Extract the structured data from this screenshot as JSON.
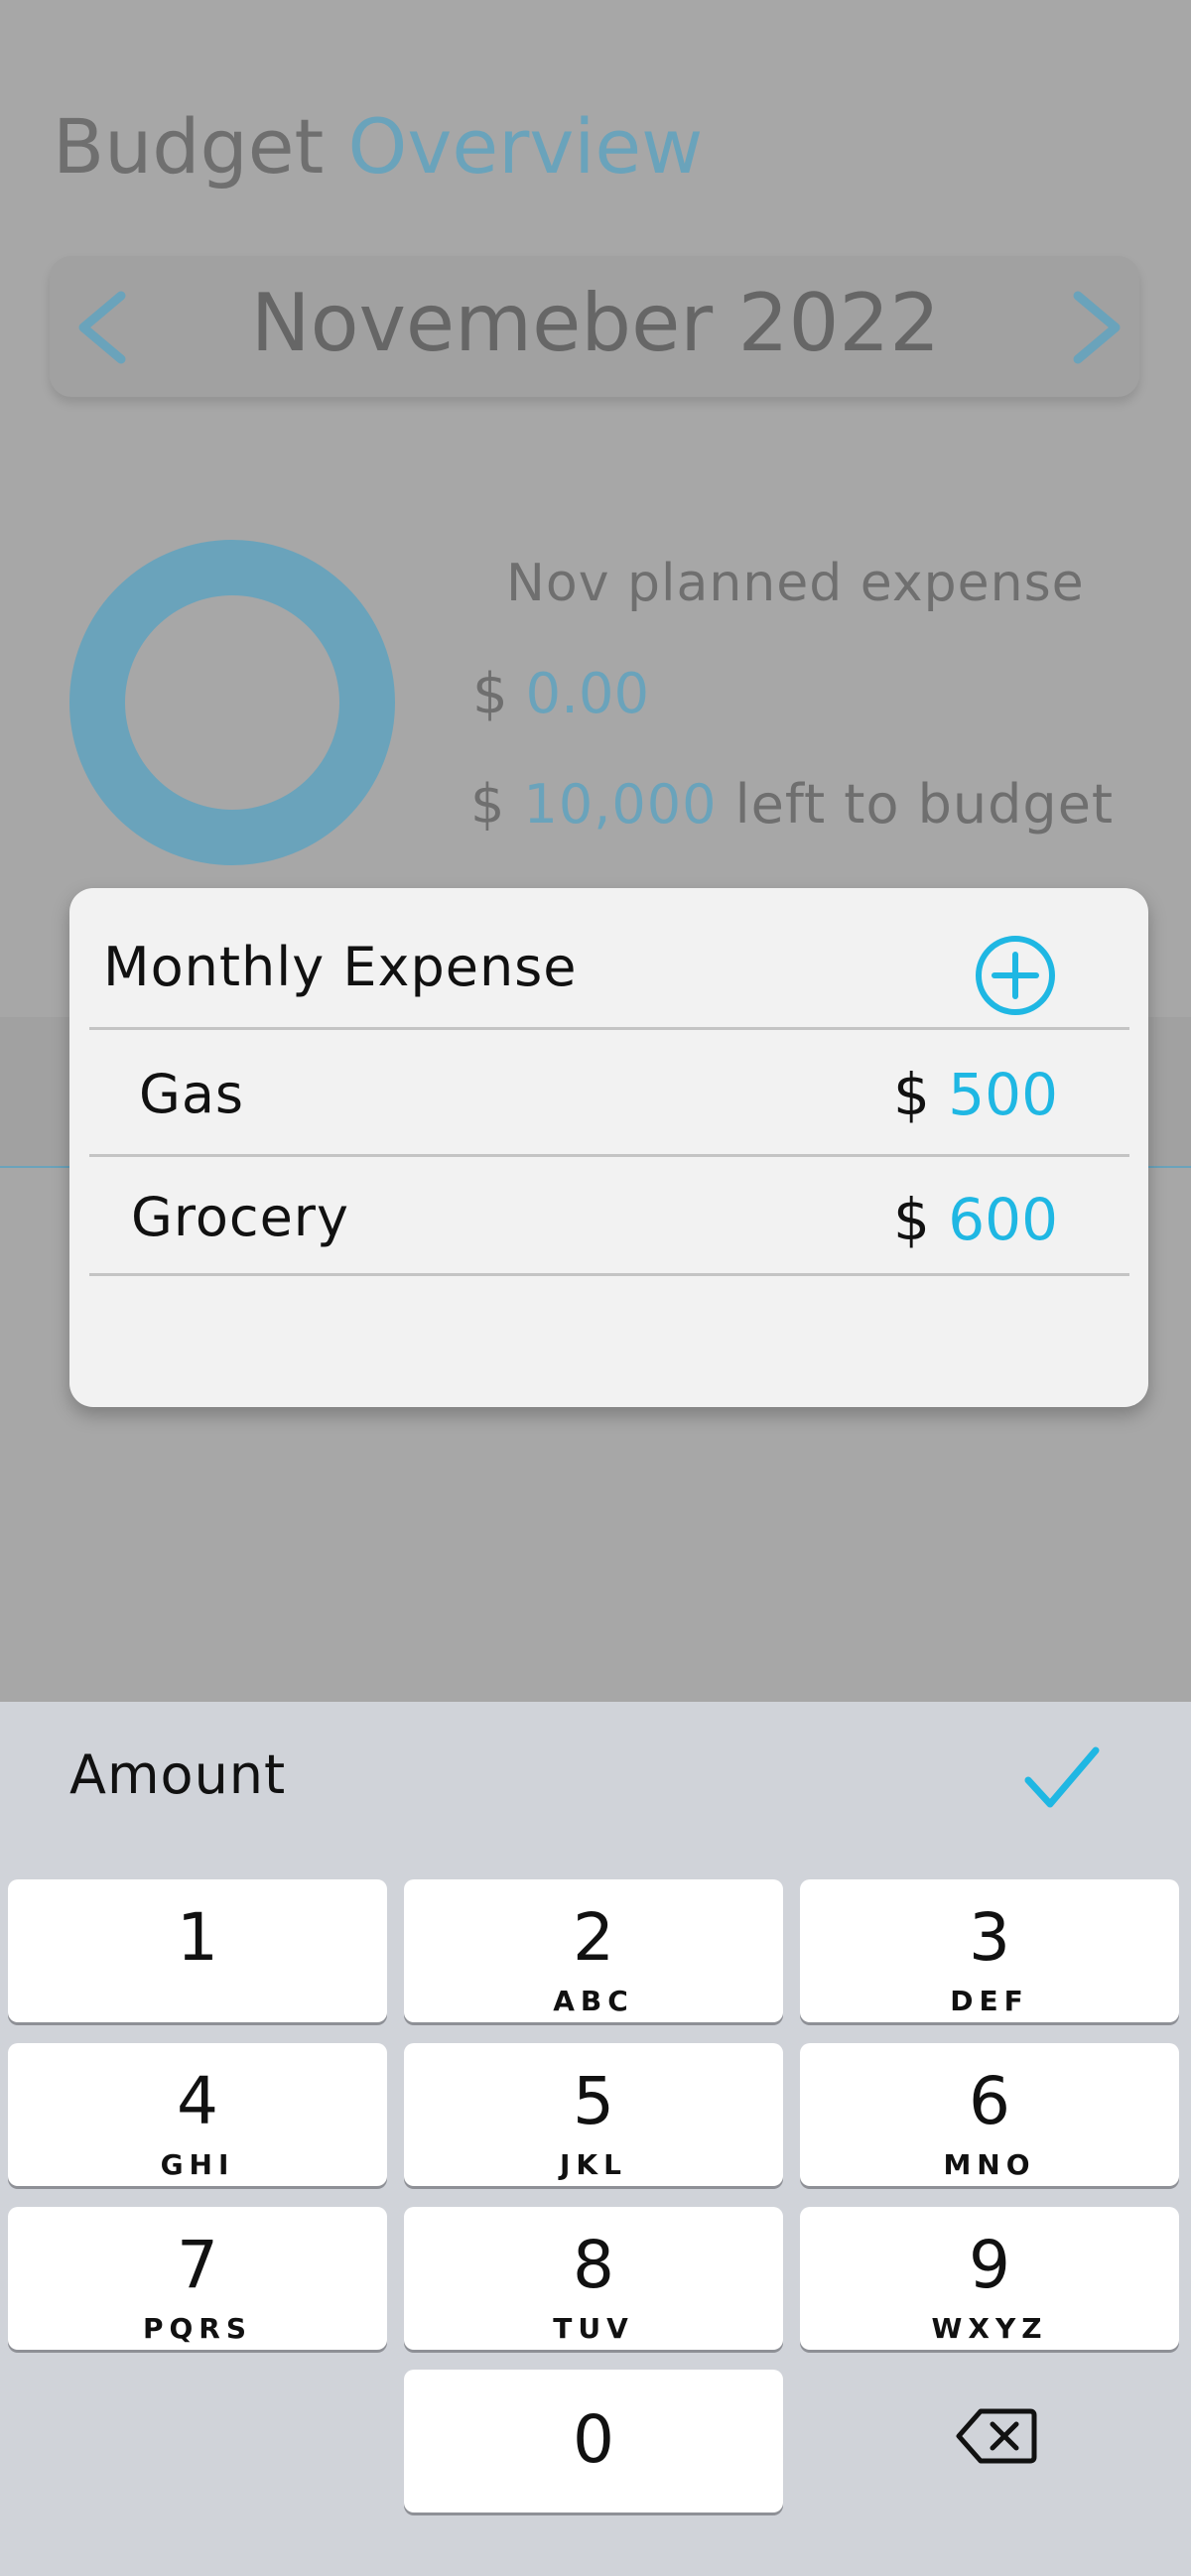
{
  "header": {
    "title_part1": "Budget",
    "title_part2": "Overview",
    "month": "Novemeber 2022"
  },
  "summary": {
    "planned_label": "Nov planned expense",
    "currency": "$",
    "planned_amount": "0.00",
    "left_amount": "10,000",
    "left_suffix": "left to budget"
  },
  "modal": {
    "title": "Monthly Expense",
    "rows": [
      {
        "name": "Gas",
        "currency": "$",
        "amount": "500"
      },
      {
        "name": "Grocery",
        "currency": "$",
        "amount": "600"
      }
    ]
  },
  "keyboard": {
    "label": "Amount",
    "keys": [
      {
        "digit": "1",
        "letters": ""
      },
      {
        "digit": "2",
        "letters": "ABC"
      },
      {
        "digit": "3",
        "letters": "DEF"
      },
      {
        "digit": "4",
        "letters": "GHI"
      },
      {
        "digit": "5",
        "letters": "JKL"
      },
      {
        "digit": "6",
        "letters": "MNO"
      },
      {
        "digit": "7",
        "letters": "PQRS"
      },
      {
        "digit": "8",
        "letters": "TUV"
      },
      {
        "digit": "9",
        "letters": "WXYZ"
      },
      {
        "digit": "0",
        "letters": ""
      }
    ]
  },
  "icons": {
    "prev": "chevron-left-icon",
    "next": "chevron-right-icon",
    "add": "plus-circle-icon",
    "confirm": "checkmark-icon",
    "delete": "backspace-icon"
  },
  "colors": {
    "accent": "#1fb7e3",
    "accent_dimmed": "#6aa3bb",
    "overlay": "#a7a7a7",
    "keyboard_bg": "#d0d3d9"
  }
}
